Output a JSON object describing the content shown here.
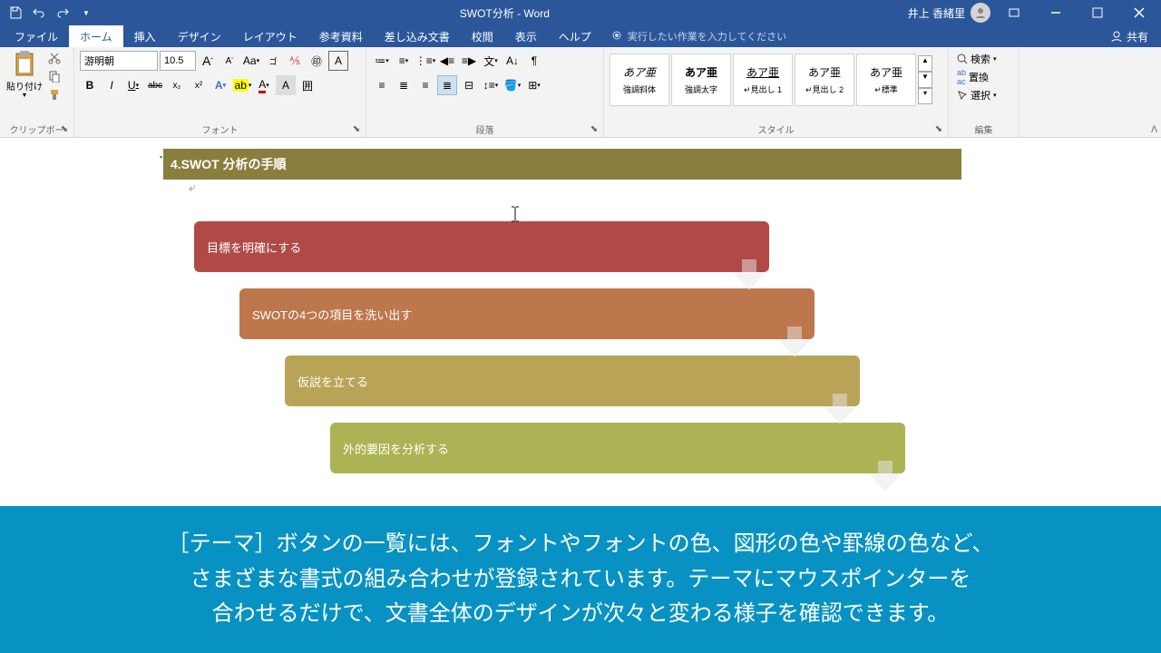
{
  "titlebar": {
    "doc_title": "SWOT分析 - Word",
    "username": "井上 香緒里"
  },
  "menu": {
    "file": "ファイル",
    "home": "ホーム",
    "insert": "挿入",
    "design": "デザイン",
    "layout": "レイアウト",
    "references": "参考資料",
    "mailings": "差し込み文書",
    "review": "校閲",
    "view": "表示",
    "help": "ヘルプ",
    "tellme_placeholder": "実行したい作業を入力してください",
    "share": "共有"
  },
  "ribbon": {
    "clipboard": {
      "paste": "貼り付け",
      "label": "クリップボード"
    },
    "font": {
      "name": "游明朝",
      "size": "10.5",
      "label": "フォント",
      "bold": "B",
      "italic": "I",
      "underline": "U",
      "strike": "abc",
      "sub": "x₂",
      "sup": "x²"
    },
    "paragraph": {
      "label": "段落"
    },
    "styles": {
      "label": "スタイル",
      "items": [
        {
          "preview": "あア亜",
          "name": "強調斜体"
        },
        {
          "preview": "あア亜",
          "name": "強調太字"
        },
        {
          "preview": "あア亜",
          "name": "見出し 1"
        },
        {
          "preview": "あア亜",
          "name": "見出し 2"
        },
        {
          "preview": "あア亜",
          "name": "標準"
        }
      ]
    },
    "editing": {
      "find": "検索",
      "replace": "置換",
      "select": "選択",
      "label": "編集"
    }
  },
  "document": {
    "heading": "4.SWOT 分析の手順",
    "step1": "目標を明確にする",
    "step2": "SWOTの4つの項目を洗い出す",
    "step3": "仮説を立てる",
    "step4": "外的要因を分析する"
  },
  "caption": {
    "line1": "［テーマ］ボタンの一覧には、フォントやフォントの色、図形の色や罫線の色など、",
    "line2": "さまざまな書式の組み合わせが登録されています。テーマにマウスポインターを",
    "line3": "合わせるだけで、文書全体のデザインが次々と変わる様子を確認できます。"
  }
}
